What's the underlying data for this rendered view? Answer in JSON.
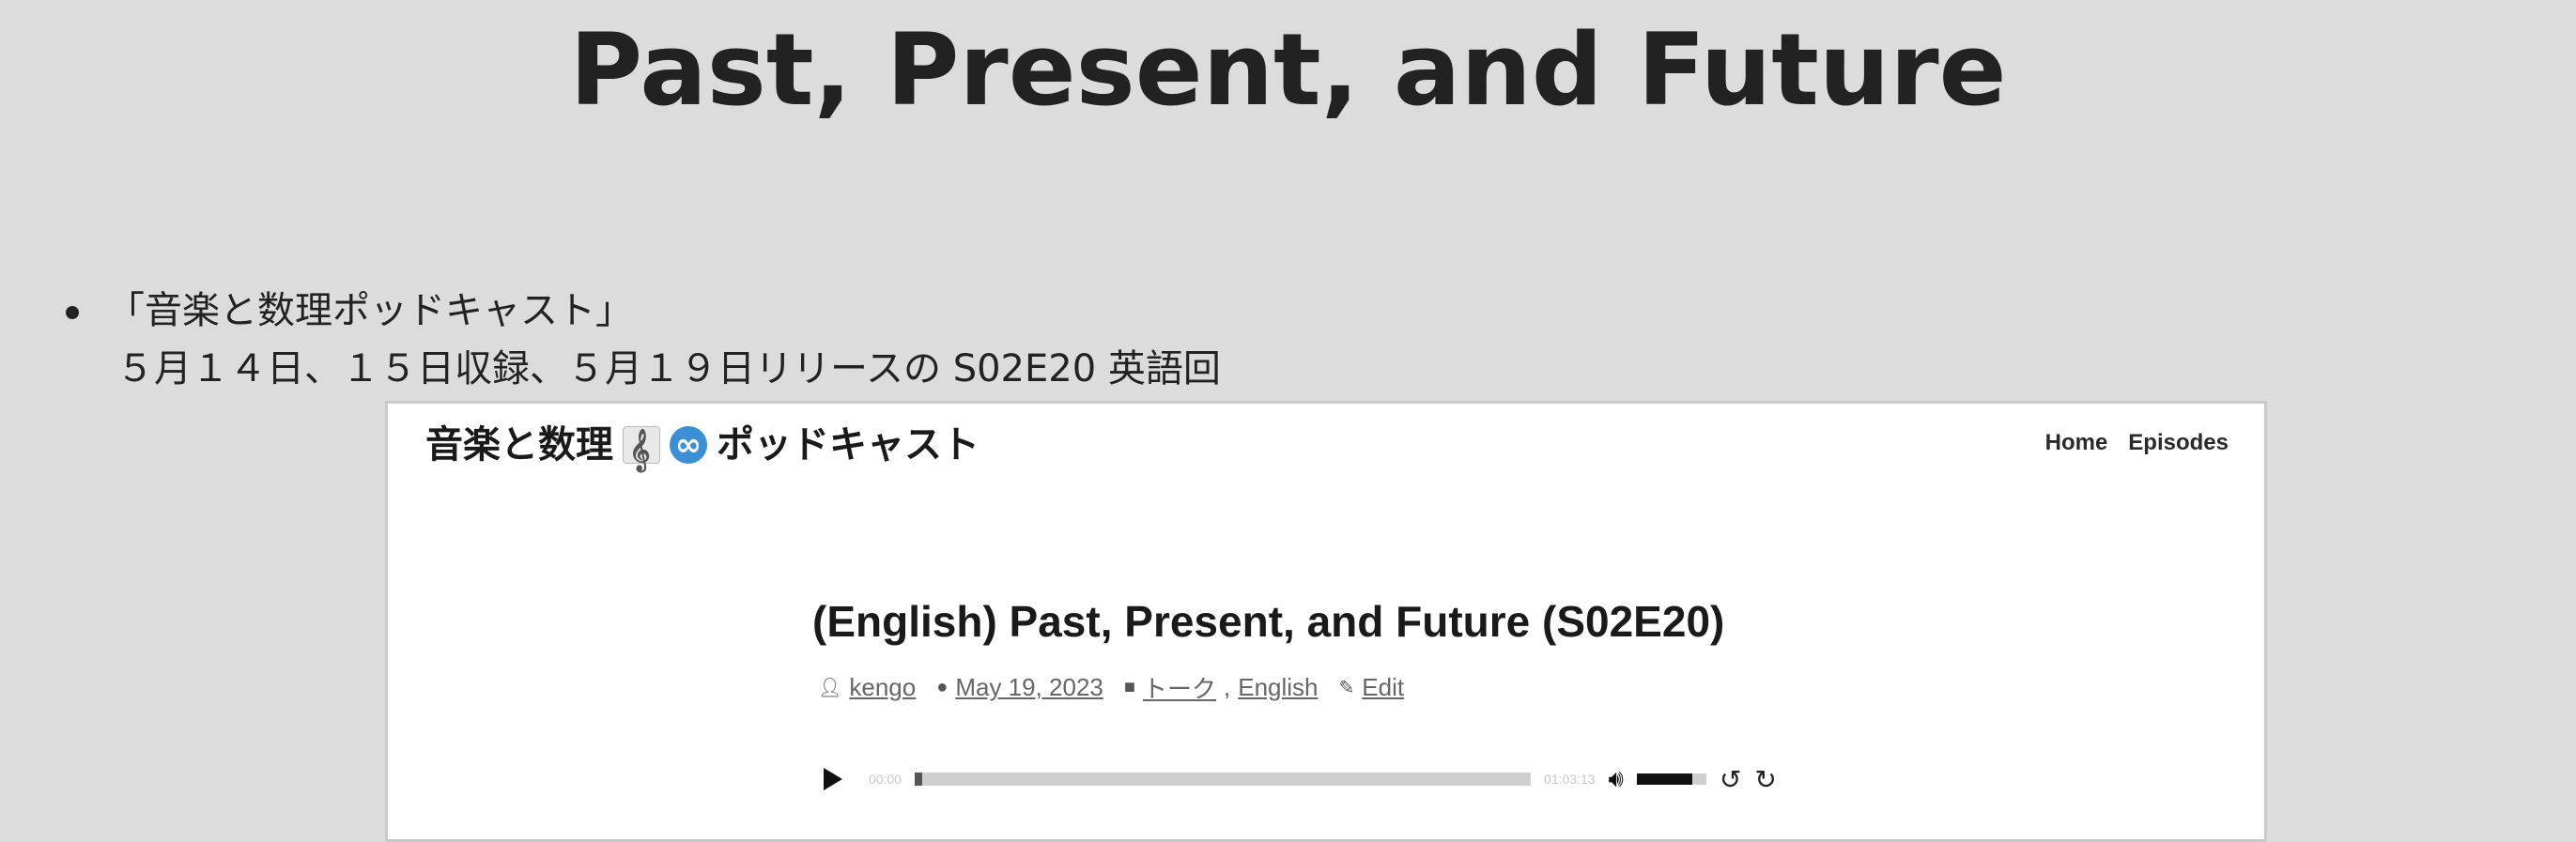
{
  "slide": {
    "title": "Past, Present, and Future",
    "bullet_line1": "「音楽と数理ポッドキャスト」",
    "bullet_line2": "５月１４日、１５日収録、５月１９日リリースの S02E20 英語回"
  },
  "site": {
    "name_part1": "音楽と数理",
    "name_part2": "ポッドキャスト",
    "icon_score": "musical-score-icon",
    "icon_infinity": "infinity-icon",
    "nav": [
      "Home",
      "Episodes"
    ]
  },
  "post": {
    "title": "(English) Past, Present, and Future (S02E20)",
    "author": "kengo",
    "date": "May 19, 2023",
    "category1": "トーク",
    "category2": "English",
    "edit": "Edit"
  },
  "player": {
    "current_time": "00:00",
    "duration": "01:03:13",
    "progress": 0.0,
    "volume": 0.8
  },
  "colors": {
    "background": "#dcdcdc",
    "text": "#222222",
    "card": "#ffffff"
  }
}
